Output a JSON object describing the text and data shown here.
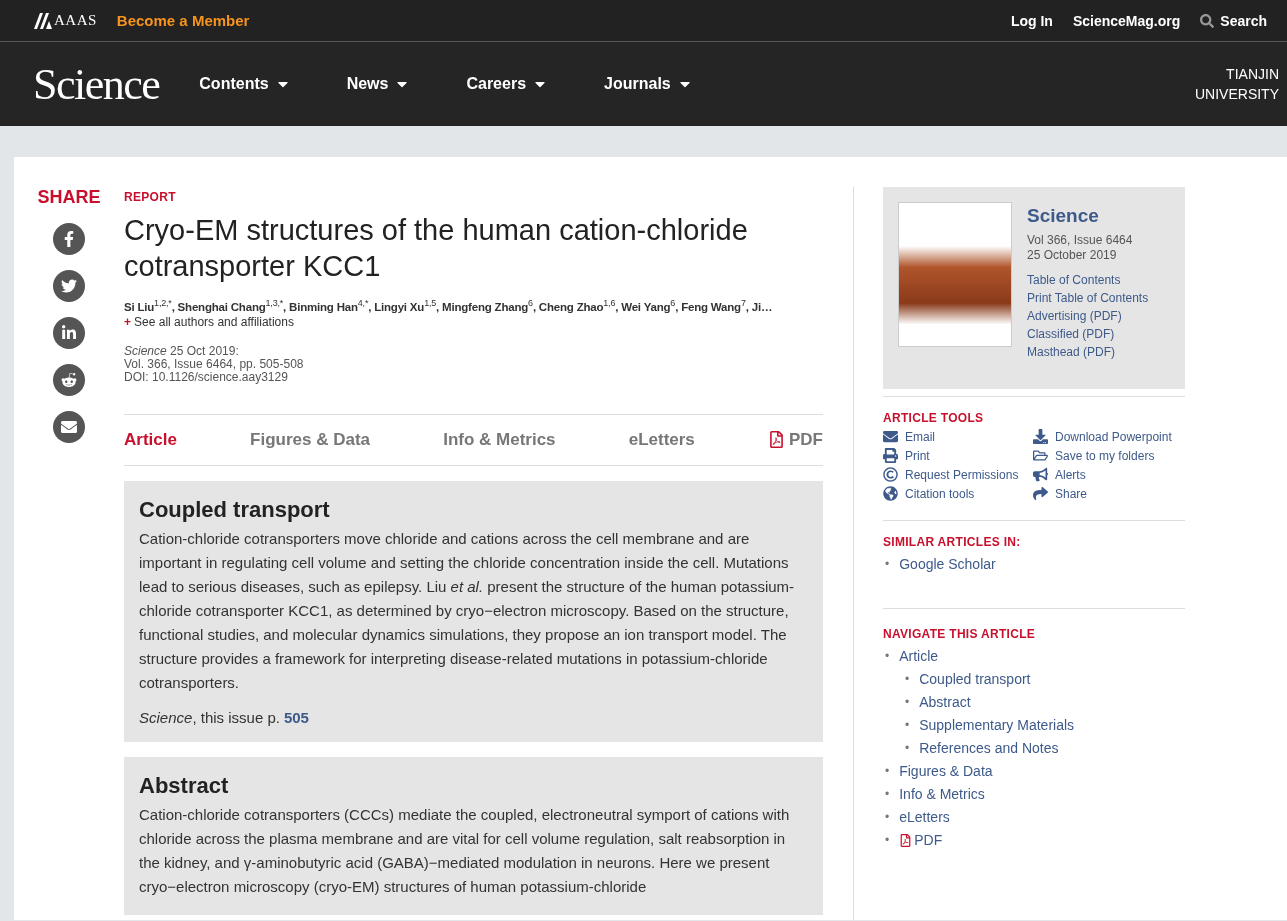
{
  "top_bar": {
    "brand": "AAAS",
    "member_link": "Become a Member",
    "links": [
      "Log In",
      "ScienceMag.org"
    ],
    "search": "Search"
  },
  "nav_bar": {
    "logo": "Science",
    "menus": [
      "Contents",
      "News",
      "Careers",
      "Journals"
    ],
    "institution": [
      "TIANJIN",
      "UNIVERSITY"
    ]
  },
  "share": {
    "title": "SHARE"
  },
  "article": {
    "type": "REPORT",
    "title": "Cryo-EM structures of the human cation-chloride cotransporter KCC1",
    "authors": "Si Liu$^{1,2,*}$, Shenghai Chang$^{1,3,*}$, Binming Han$^{4,*}$, Lingyi Xu$^{1,5}$, Mingfeng Zhang$^{6}$, Cheng Zhao$^{1,6}$, Wei Yang$^{6}$, Feng Wang$^{7}$, Ji…",
    "affiliations_toggle": "+",
    "affiliations_link": "See all authors and affiliations",
    "citation": [
      "*Science*  25 Oct 2019:",
      "Vol. 366, Issue 6464, pp. 505-508",
      "DOI: 10.1126/science.aay3129"
    ]
  },
  "tabs": [
    {
      "label": "Article",
      "selected": true
    },
    {
      "label": "Figures & Data",
      "selected": false
    },
    {
      "label": "Info & Metrics",
      "selected": false
    },
    {
      "label": "eLetters",
      "selected": false
    },
    {
      "label": "PDF",
      "selected": false,
      "kind": "pdf"
    }
  ],
  "summary": {
    "heading": "Coupled transport",
    "text": "Cation-chloride cotransporters move chloride and cations across the cell membrane and are important in regulating cell volume and setting the chloride concentration inside the cell. Mutations lead to serious diseases, such as epilepsy. Liu *et al.* present the structure of the human potassium-chloride cotransporter KCC1, as determined by cryo−electron microscopy. Based on the structure, functional studies, and molecular dynamics simulations, they propose an ion transport model. The structure provides a framework for interpreting disease-related mutations in potassium-chloride cotransporters.",
    "source": "*Science*, this issue p.",
    "page_link": "505"
  },
  "abstract": {
    "heading": "Abstract",
    "text": "Cation-chloride cotransporters (CCCs) mediate the coupled, electroneutral symport of cations with chloride across the plasma membrane and are vital for cell volume regulation, salt reabsorption in the kidney, and γ-aminobutyric acid (GABA)−mediated modulation in neurons. Here we present cryo−electron microscopy (cryo-EM) structures of human potassium-chloride"
  },
  "issue_box": {
    "journal": "Science",
    "issue": "Vol 366, Issue 6464",
    "date": "25 October 2019",
    "links": [
      "Table of Contents",
      "Print Table of Contents",
      "Advertising (PDF)",
      "Classified (PDF)",
      "Masthead (PDF)"
    ]
  },
  "article_tools": {
    "title": "ARTICLE TOOLS",
    "items": [
      "Email",
      "Download Powerpoint",
      "Print",
      "Save to my folders",
      "Request Permissions",
      "Alerts",
      "Citation tools",
      "Share"
    ]
  },
  "similar_articles": {
    "title": "SIMILAR ARTICLES IN:",
    "items": [
      {
        "bullet": "•",
        "label": "Google Scholar"
      }
    ]
  },
  "navigate": {
    "title": "NAVIGATE THIS ARTICLE",
    "items": [
      {
        "bullet": "•",
        "label": "Article",
        "children": [
          {
            "bullet": "•",
            "label": "Coupled transport"
          },
          {
            "bullet": "•",
            "label": "Abstract"
          },
          {
            "bullet": "•",
            "label": "Supplementary Materials"
          },
          {
            "bullet": "•",
            "label": "References and Notes"
          }
        ]
      },
      {
        "bullet": "•",
        "label": "Figures & Data"
      },
      {
        "bullet": "•",
        "label": "Info & Metrics"
      },
      {
        "bullet": "•",
        "label": "eLetters"
      },
      {
        "bullet": "•",
        "label": "PDF",
        "kind": "pdf"
      }
    ]
  }
}
